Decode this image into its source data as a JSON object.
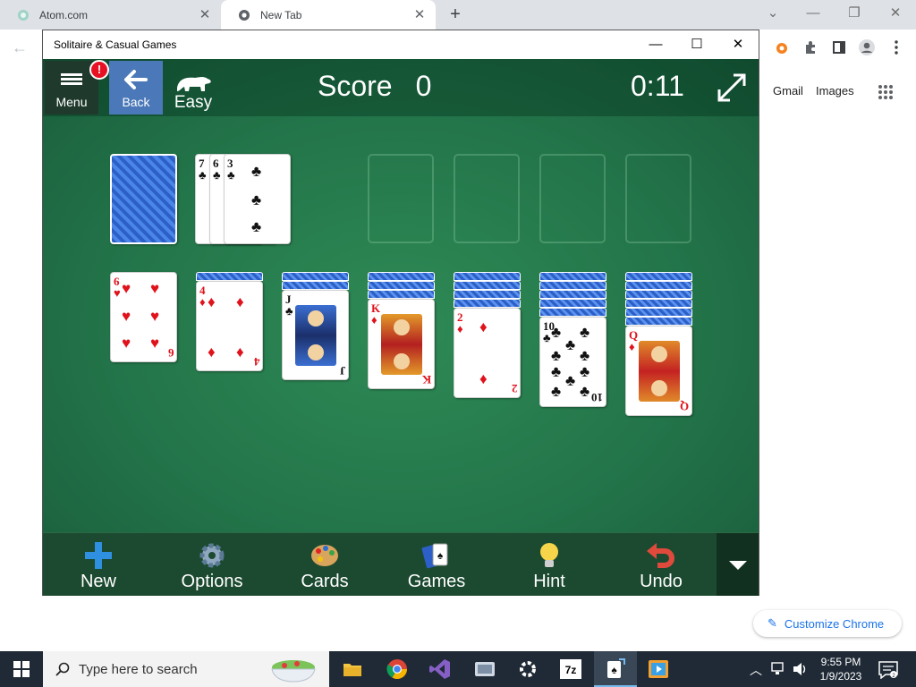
{
  "browser": {
    "tabs": [
      {
        "title": "Atom.com"
      },
      {
        "title": "New Tab"
      }
    ],
    "ntp": {
      "gmail": "Gmail",
      "images": "Images",
      "customize": "Customize Chrome"
    }
  },
  "app": {
    "title": "Solitaire & Casual Games",
    "menu_label": "Menu",
    "alert_badge": "!",
    "back_label": "Back",
    "difficulty": "Easy",
    "score_label": "Score",
    "score_value": "0",
    "timer": "0:11",
    "waste_cards": [
      {
        "rank": "7",
        "suit": "♣"
      },
      {
        "rank": "6",
        "suit": "♣"
      },
      {
        "rank": "3",
        "suit": "♣"
      }
    ],
    "tableau": [
      {
        "rank": "6",
        "suit": "♥",
        "color": "red",
        "facedown": 0
      },
      {
        "rank": "4",
        "suit": "♦",
        "color": "red",
        "facedown": 1
      },
      {
        "rank": "J",
        "suit": "♣",
        "color": "black",
        "facedown": 2
      },
      {
        "rank": "K",
        "suit": "♦",
        "color": "red",
        "facedown": 3
      },
      {
        "rank": "2",
        "suit": "♦",
        "color": "red",
        "facedown": 4
      },
      {
        "rank": "10",
        "suit": "♣",
        "color": "black",
        "facedown": 5
      },
      {
        "rank": "Q",
        "suit": "♦",
        "color": "red",
        "facedown": 6
      }
    ],
    "toolbar": {
      "new": "New",
      "options": "Options",
      "cards": "Cards",
      "games": "Games",
      "hint": "Hint",
      "undo": "Undo"
    }
  },
  "taskbar": {
    "search_placeholder": "Type here to search",
    "time": "9:55 PM",
    "date": "1/9/2023"
  },
  "colors": {
    "felt": "#23754a",
    "card_red": "#e0121c",
    "card_back": "#2d5fc8"
  }
}
